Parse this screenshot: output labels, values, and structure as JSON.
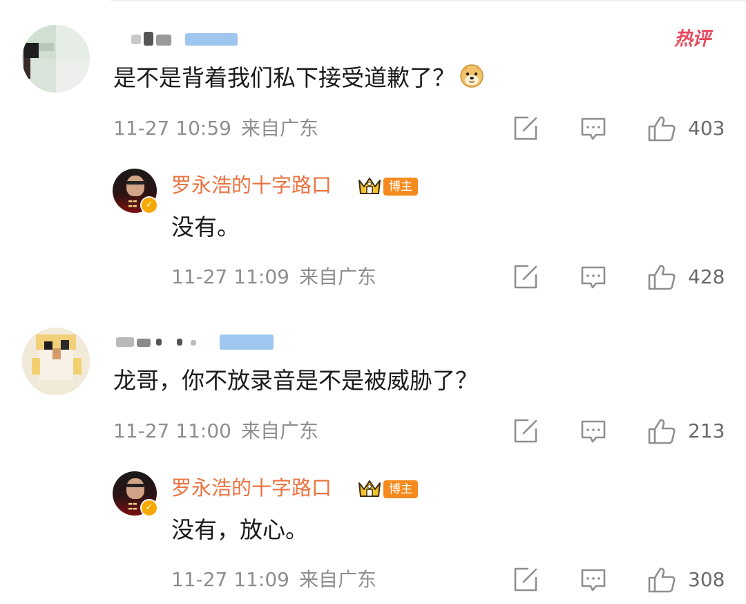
{
  "hot_tag": "热评",
  "comments": [
    {
      "text": "是不是背着我们私下接受道歉了？",
      "emoji": "doge-emoji",
      "time": "11-27 10:59",
      "location": "来自广东",
      "likes": "403",
      "reply": {
        "author": "罗永浩的十字路口",
        "badge": "博主",
        "text": "没有。",
        "time": "11-27 11:09",
        "location": "来自广东",
        "likes": "428"
      }
    },
    {
      "text": "龙哥，你不放录音是不是被威胁了？",
      "time": "11-27 11:00",
      "location": "来自广东",
      "likes": "213",
      "reply": {
        "author": "罗永浩的十字路口",
        "badge": "博主",
        "text": "没有，放心。",
        "time": "11-27 11:09",
        "location": "来自广东",
        "likes": "308"
      }
    }
  ],
  "icons": {
    "edit": "share-edit-icon",
    "comment": "comment-icon",
    "like": "thumbs-up-icon",
    "crown": "crown-icon",
    "verified": "verified-badge-icon"
  },
  "colors": {
    "author": "#eb7340",
    "badge": "#f58b1f",
    "hot": "#e84a5f",
    "meta": "#8e8e8e"
  }
}
